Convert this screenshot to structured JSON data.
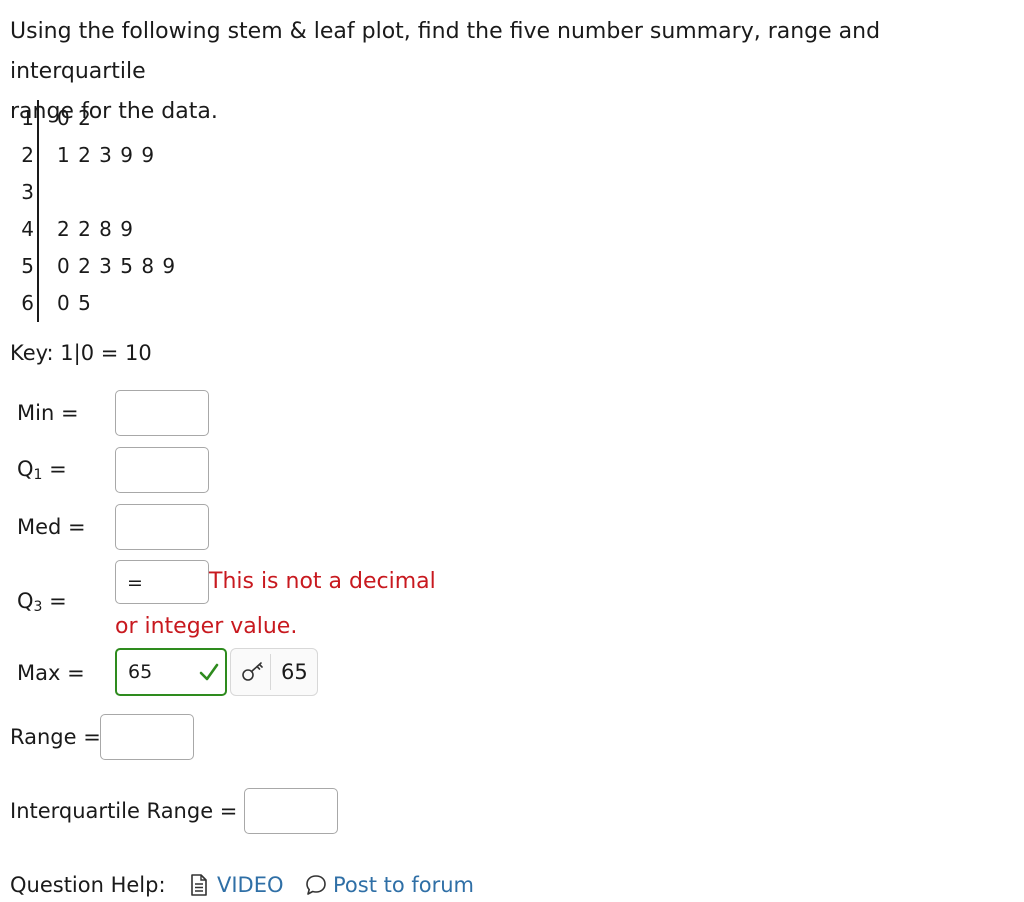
{
  "question": {
    "line1": "Using the following stem & leaf plot, find the five number summary, range and interquartile",
    "line2": "range for the data."
  },
  "stem_leaf": {
    "rows": [
      {
        "stem": "1",
        "leaves": "0 2"
      },
      {
        "stem": "2",
        "leaves": "1 2 3 9 9"
      },
      {
        "stem": "3",
        "leaves": ""
      },
      {
        "stem": "4",
        "leaves": "2 2 8 9"
      },
      {
        "stem": "5",
        "leaves": "0 2 3 5 8 9"
      },
      {
        "stem": "6",
        "leaves": "0 5"
      }
    ],
    "key": "Key: 1|0 = 10"
  },
  "fields": {
    "min": {
      "label": "Min =",
      "value": ""
    },
    "q1": {
      "label_main": "Q",
      "label_sub": "1",
      "label_tail": " =",
      "value": ""
    },
    "med": {
      "label": "Med =",
      "value": ""
    },
    "q3": {
      "label_main": "Q",
      "label_sub": "3",
      "label_tail": " =",
      "value": "=",
      "error_line1": "This is not a decimal",
      "error_line2": "or integer value."
    },
    "max": {
      "label": "Max =",
      "value": "65",
      "answer": "65"
    },
    "range": {
      "label": "Range =",
      "value": ""
    },
    "iqr": {
      "label": "Interquartile Range =",
      "value": ""
    }
  },
  "help": {
    "label": "Question Help:",
    "video_label": "VIDEO",
    "forum_label": "Post to forum"
  },
  "colors": {
    "correct": "#2e8b1e",
    "error": "#c8191f",
    "link": "#2f6fa6"
  }
}
